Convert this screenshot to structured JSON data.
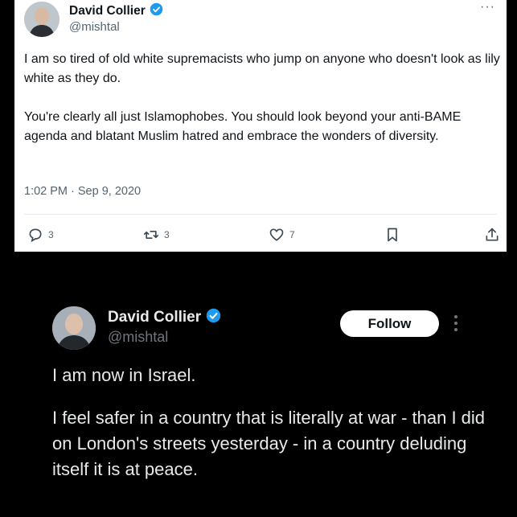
{
  "tweet1": {
    "author": {
      "name": "David Collier",
      "handle": "@mishtal",
      "verified": true
    },
    "more_label": "···",
    "paragraphs": [
      "I am so tired of old white supremacists who jump on anyone who doesn't look as lily white as they do.",
      "You're clearly all just Islamophobes. You should look beyond your anti-BAME agenda and blatant Muslim hatred and embrace the wonders of diversity."
    ],
    "timestamp": "1:02 PM · Sep 9, 2020",
    "actions": {
      "replies": "3",
      "retweets": "3",
      "likes": "7"
    },
    "colors": {
      "verified": "#1d9bf0",
      "text": "#0f1419",
      "muted": "#536471"
    }
  },
  "tweet2": {
    "author": {
      "name": "David Collier",
      "handle": "@mishtal",
      "verified": true
    },
    "follow_label": "Follow",
    "paragraphs": [
      "I am now in Israel.",
      "I feel safer in a country that is literally at war - than I did on London's streets yesterday - in a country deluding itself it is at peace."
    ],
    "colors": {
      "verified": "#1d9bf0",
      "text": "#e7e9ea",
      "muted": "#71767b"
    }
  }
}
